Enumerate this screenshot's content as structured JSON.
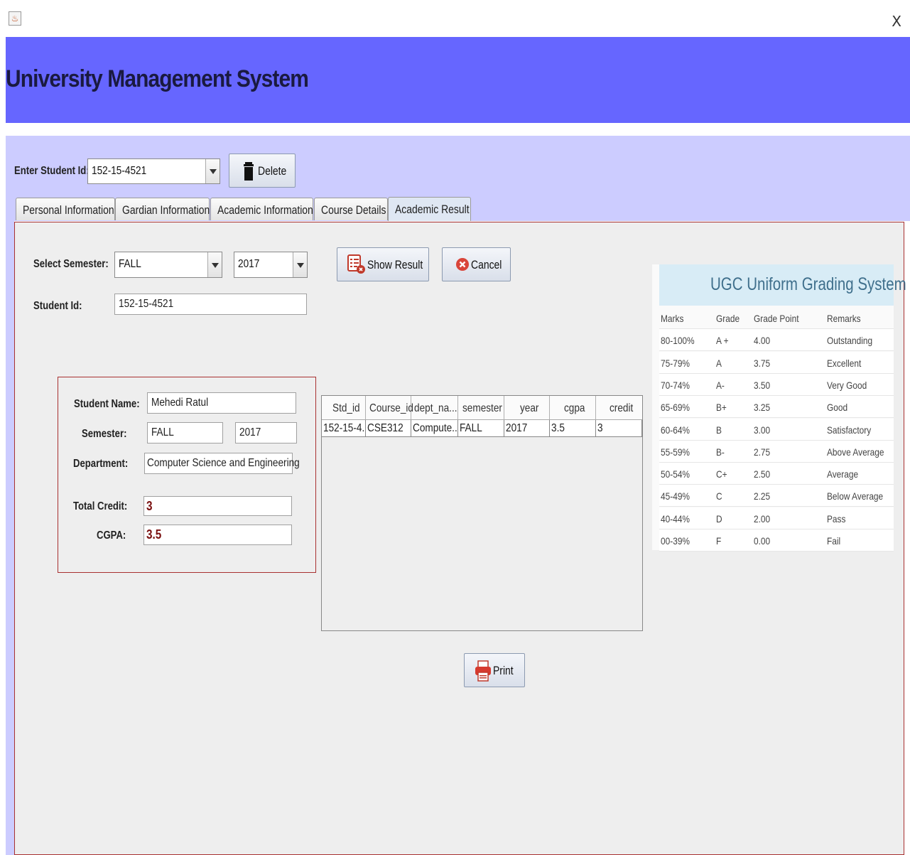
{
  "window": {
    "close_label": "X"
  },
  "header": {
    "title": "University Management System"
  },
  "top": {
    "student_id_label": "Enter Student Id:",
    "student_id_value": "152-15-4521",
    "delete_label": "Delete"
  },
  "tabs": [
    {
      "label": "Personal Information",
      "active": false
    },
    {
      "label": "Gardian Information",
      "active": false
    },
    {
      "label": "Academic Information",
      "active": false
    },
    {
      "label": "Course Details",
      "active": false
    },
    {
      "label": "Academic Result",
      "active": true
    }
  ],
  "form": {
    "semester_label": "Select Semester:",
    "semester_value": "FALL",
    "year_value": "2017",
    "show_result_label": "Show Result",
    "cancel_label": "Cancel",
    "student_id_label": "Student Id:",
    "student_id_value": "152-15-4521"
  },
  "info": {
    "name_label": "Student Name:",
    "name_value": "Mehedi Ratul",
    "semester_label": "Semester:",
    "semester_value": "FALL",
    "year_value": "2017",
    "department_label": "Department:",
    "department_value": "Computer Science and Engineering",
    "credit_label": "Total Credit:",
    "credit_value": "3",
    "cgpa_label": "CGPA:",
    "cgpa_value": "3.5"
  },
  "result_table": {
    "columns": [
      "Std_id",
      "Course_id",
      "dept_na...",
      "semester",
      "year",
      "cgpa",
      "credit"
    ],
    "rows": [
      [
        "152-15-4...",
        "CSE312",
        "Compute...",
        "FALL",
        "2017",
        "3.5",
        "3"
      ]
    ]
  },
  "print_label": "Print",
  "grading": {
    "title": "UGC Uniform Grading System",
    "columns": [
      "Marks",
      "Grade",
      "Grade Point",
      "Remarks"
    ],
    "rows": [
      [
        "80-100%",
        "A +",
        "4.00",
        "Outstanding"
      ],
      [
        "75-79%",
        "A",
        "3.75",
        "Excellent"
      ],
      [
        "70-74%",
        "A-",
        "3.50",
        "Very Good"
      ],
      [
        "65-69%",
        "B+",
        "3.25",
        "Good"
      ],
      [
        "60-64%",
        "B",
        "3.00",
        "Satisfactory"
      ],
      [
        "55-59%",
        "B-",
        "2.75",
        "Above Average"
      ],
      [
        "50-54%",
        "C+",
        "2.50",
        "Average"
      ],
      [
        "45-49%",
        "C",
        "2.25",
        "Below Average"
      ],
      [
        "40-44%",
        "D",
        "2.00",
        "Pass"
      ],
      [
        "00-39%",
        "F",
        "0.00",
        "Fail"
      ]
    ]
  }
}
